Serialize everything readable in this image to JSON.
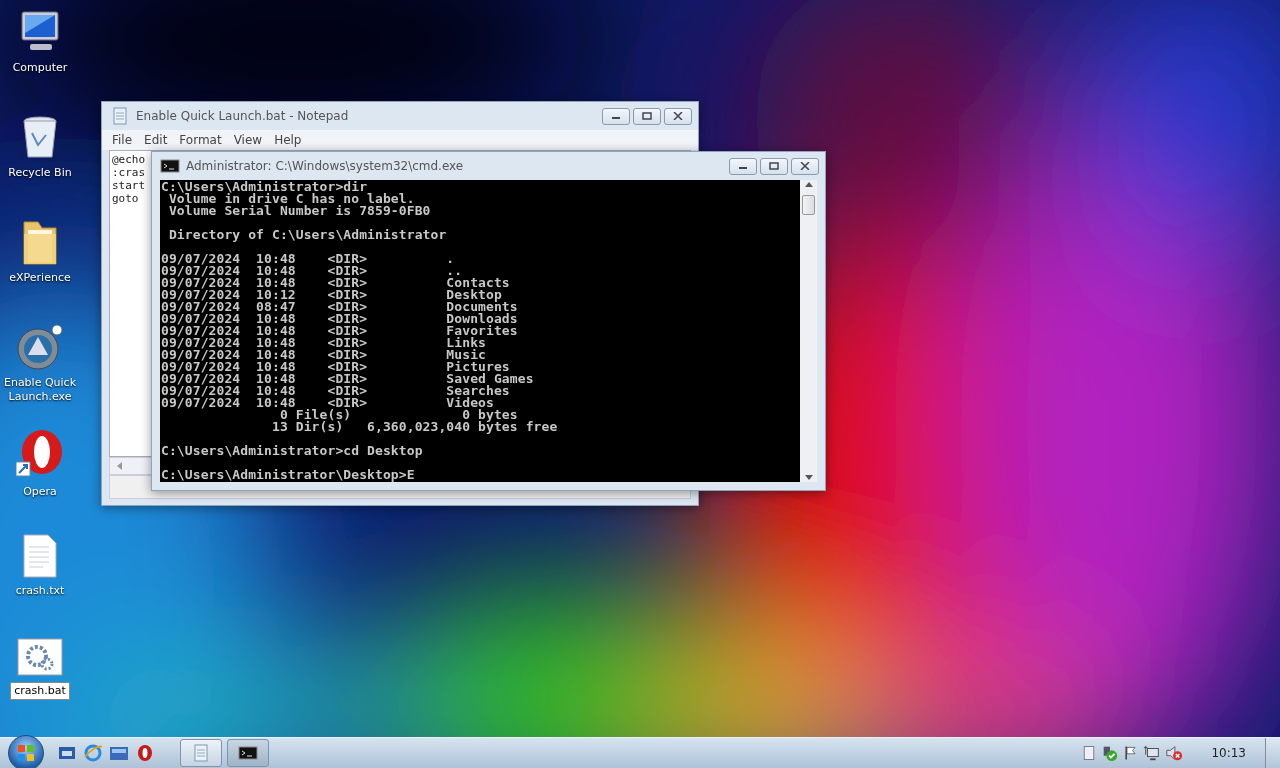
{
  "desktop_icons": [
    {
      "kind": "computer",
      "label": "Computer",
      "selected": false
    },
    {
      "kind": "recycle",
      "label": "Recycle Bin",
      "selected": false
    },
    {
      "kind": "folder",
      "label": "eXPerience",
      "selected": false
    },
    {
      "kind": "app",
      "label": "Enable Quick Launch.exe",
      "selected": false
    },
    {
      "kind": "opera",
      "label": "Opera",
      "selected": false
    },
    {
      "kind": "text",
      "label": "crash.txt",
      "selected": false
    },
    {
      "kind": "batch",
      "label": "crash.bat",
      "selected": true
    }
  ],
  "notepad": {
    "title": "Enable Quick Launch.bat - Notepad",
    "menu": [
      "File",
      "Edit",
      "Format",
      "View",
      "Help"
    ],
    "lines": [
      "@echo",
      ":cras",
      "start",
      "goto"
    ]
  },
  "cmd": {
    "title": "Administrator: C:\\Windows\\system32\\cmd.exe",
    "blocks": [
      [
        "C:\\Users\\Administrator>dir",
        " Volume in drive C has no label.",
        " Volume Serial Number is 7859-0FB0"
      ],
      [
        " Directory of C:\\Users\\Administrator"
      ],
      [
        "09/07/2024  10:48    <DIR>          .",
        "09/07/2024  10:48    <DIR>          ..",
        "09/07/2024  10:48    <DIR>          Contacts",
        "09/07/2024  10:12    <DIR>          Desktop",
        "09/07/2024  08:47    <DIR>          Documents",
        "09/07/2024  10:48    <DIR>          Downloads",
        "09/07/2024  10:48    <DIR>          Favorites",
        "09/07/2024  10:48    <DIR>          Links",
        "09/07/2024  10:48    <DIR>          Music",
        "09/07/2024  10:48    <DIR>          Pictures",
        "09/07/2024  10:48    <DIR>          Saved Games",
        "09/07/2024  10:48    <DIR>          Searches",
        "09/07/2024  10:48    <DIR>          Videos",
        "               0 File(s)              0 bytes",
        "              13 Dir(s)   6,360,023,040 bytes free"
      ],
      [
        "C:\\Users\\Administrator>cd Desktop"
      ],
      [
        "C:\\Users\\Administrator\\Desktop>E"
      ]
    ]
  },
  "taskbar": {
    "quick_launch": [
      {
        "kind": "desktop"
      },
      {
        "kind": "ie"
      },
      {
        "kind": "switch"
      },
      {
        "kind": "opera"
      }
    ],
    "tasks": [
      {
        "kind": "notepad",
        "selected": false
      },
      {
        "kind": "cmd",
        "selected": true
      }
    ],
    "tray": [
      {
        "kind": "doc"
      },
      {
        "kind": "shield"
      },
      {
        "kind": "flag"
      },
      {
        "kind": "network"
      },
      {
        "kind": "volume"
      }
    ],
    "clock": "10:13"
  }
}
